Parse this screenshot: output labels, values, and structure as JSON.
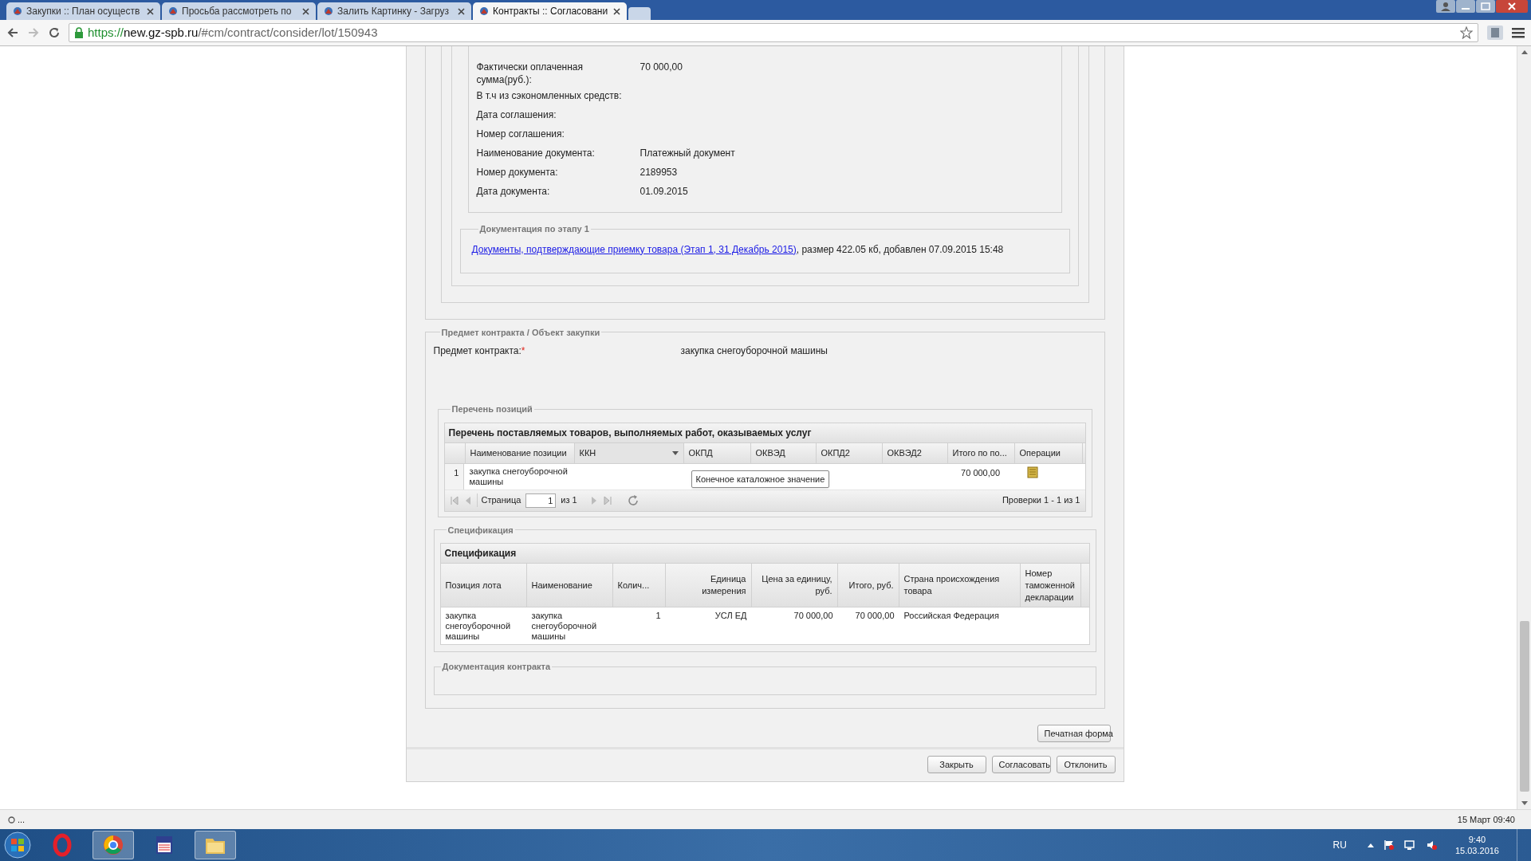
{
  "browser": {
    "tabs": [
      {
        "title": "Закупки :: План осуществ",
        "selected": false
      },
      {
        "title": "Просьба рассмотреть по",
        "selected": false
      },
      {
        "title": "Залить Картинку - Загруз",
        "selected": false
      },
      {
        "title": "Контракты :: Согласовани",
        "selected": true
      }
    ],
    "url_scheme": "https://",
    "url_host": "new.gz-spb.ru",
    "url_path": "/#cm/contract/consider/lot/150943",
    "status_text": "...",
    "status_time": "15 Март 09:40"
  },
  "payment": {
    "fields": [
      {
        "label": "Фактически оплаченная сумма(руб.):",
        "value": "70 000,00"
      },
      {
        "label": "В т.ч из сэкономленных средств:"
      },
      {
        "label": "Дата соглашения:"
      },
      {
        "label": "Номер соглашения:"
      },
      {
        "label": "Наименование документа:",
        "value": "Платежный документ"
      },
      {
        "label": "Номер документа:",
        "value": "2189953"
      },
      {
        "label": "Дата документа:",
        "value": "01.09.2015"
      }
    ]
  },
  "stage_docs": {
    "legend": "Документация по этапу 1",
    "link": "Документы, подтверждающие приемку товара (Этап 1, 31 Декабрь 2015)",
    "info": ", размер 422.05 кб, добавлен 07.09.2015 15:48"
  },
  "subject": {
    "legend": "Предмет контракта / Объект закупки",
    "label": "Предмет контракта:",
    "required": true,
    "required_mark": "*",
    "value": "закупка снегоуборочной машины"
  },
  "positions": {
    "legend": "Перечень позиций",
    "title": "Перечень поставляемых товаров, выполняемых работ, оказываемых услуг",
    "columns": [
      "Наименование позиции",
      "ККН",
      "ОКПД",
      "ОКВЭД",
      "ОКПД2",
      "ОКВЭД2",
      "Итого по по...",
      "Операции"
    ],
    "rows": [
      {
        "num": "1",
        "name": "закупка снегоуборочной машины",
        "total": "70 000,00"
      }
    ],
    "tooltip": "Конечное каталожное значение",
    "pager": {
      "page_label": "Страница",
      "page": "1",
      "of": "из 1",
      "summary": "Проверки 1 - 1 из 1"
    }
  },
  "specification": {
    "legend": "Спецификация",
    "title": "Спецификация",
    "columns": [
      "Позиция лота",
      "Наименование",
      "Колич...",
      "Единица измерения",
      "Цена за единицу, руб.",
      "Итого, руб.",
      "Страна происхождения товара",
      "Номер таможенной декларации"
    ],
    "rows": [
      [
        "закупка снегоуборочной машины",
        "закупка снегоуборочной машины",
        "1",
        "УСЛ ЕД",
        "70 000,00",
        "70 000,00",
        "Российская Федерация",
        null
      ]
    ]
  },
  "contract_docs": {
    "legend": "Документация контракта"
  },
  "print_button": "Печатная форма",
  "buttons": [
    "Закрыть",
    "Согласовать",
    "Отклонить"
  ],
  "taskbar": {
    "apps": [
      {
        "kind": "ring",
        "running": false
      },
      {
        "kind": "wheel",
        "running": true
      },
      {
        "kind": "floppy",
        "running": false
      },
      {
        "kind": "folder",
        "running": true
      }
    ],
    "lang": "RU",
    "time": "9:40",
    "date": "15.03.2016"
  }
}
